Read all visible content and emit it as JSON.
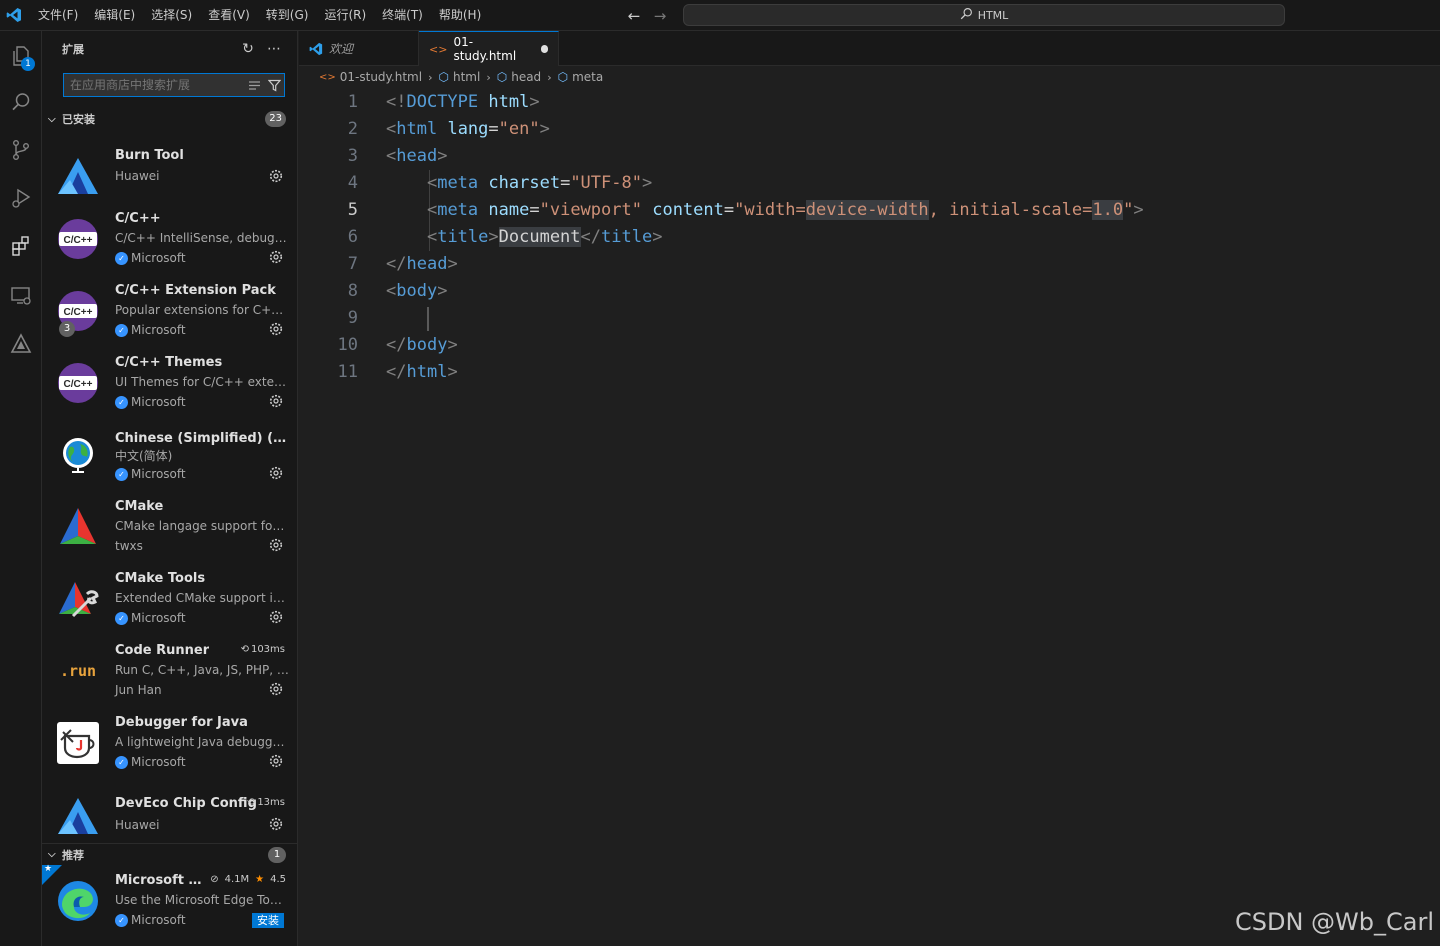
{
  "menu": [
    "文件(F)",
    "编辑(E)",
    "选择(S)",
    "查看(V)",
    "转到(G)",
    "运行(R)",
    "终端(T)",
    "帮助(H)"
  ],
  "command_center": {
    "text": "HTML"
  },
  "activity": {
    "explorer_badge": "1"
  },
  "sidebar": {
    "title": "扩展",
    "search_placeholder": "在应用商店中搜索扩展",
    "installed": {
      "label": "已安装",
      "count": "23",
      "items": [
        {
          "name": "Burn Tool",
          "desc": "",
          "publisher": "Huawei",
          "verified": false
        },
        {
          "name": "C/C++",
          "desc": "C/C++ IntelliSense, debugging, and code browsing.",
          "publisher": "Microsoft",
          "verified": true
        },
        {
          "name": "C/C++ Extension Pack",
          "desc": "Popular extensions for C++ development in Visual Studio Code.",
          "publisher": "Microsoft",
          "verified": true,
          "pack_count": "3"
        },
        {
          "name": "C/C++ Themes",
          "desc": "UI Themes for C/C++ extension.",
          "publisher": "Microsoft",
          "verified": true
        },
        {
          "name": "Chinese (Simplified) (简体中文) Language Pack",
          "desc": "中文(简体)",
          "publisher": "Microsoft",
          "verified": true
        },
        {
          "name": "CMake",
          "desc": "CMake langage support for Visual Studio Code",
          "publisher": "twxs",
          "verified": false
        },
        {
          "name": "CMake Tools",
          "desc": "Extended CMake support in Visual Studio Code",
          "publisher": "Microsoft",
          "verified": true
        },
        {
          "name": "Code Runner",
          "desc": "Run C, C++, Java, JS, PHP, Python, Perl",
          "publisher": "Jun Han",
          "verified": false,
          "time": "103ms"
        },
        {
          "name": "Debugger for Java",
          "desc": "A lightweight Java debugger for Visual Studio Code",
          "publisher": "Microsoft",
          "verified": true
        },
        {
          "name": "DevEco Chip Config",
          "desc": "",
          "publisher": "Huawei",
          "verified": false,
          "time": "13ms"
        }
      ]
    },
    "recommended": {
      "label": "推荐",
      "count": "1",
      "item": {
        "name": "Microsoft Edge Tools for VS Code",
        "desc": "Use the Microsoft Edge Tools from within VS Code",
        "publisher": "Microsoft",
        "downloads": "4.1M",
        "rating": "4.5",
        "install": "安装"
      }
    }
  },
  "tabs": [
    {
      "label": "欢迎"
    },
    {
      "label": "01-study.html"
    }
  ],
  "breadcrumb": [
    "01-study.html",
    "html",
    "head",
    "meta"
  ],
  "code": {
    "current_line": 5,
    "line_numbers": [
      "1",
      "2",
      "3",
      "4",
      "5",
      "6",
      "7",
      "8",
      "9",
      "10",
      "11"
    ]
  },
  "watermark": "CSDN @Wb_Carl",
  "colors": {
    "accent": "#0078d4",
    "tag": "#569cd6",
    "attribute": "#9cdcfe",
    "string": "#ce9178"
  }
}
